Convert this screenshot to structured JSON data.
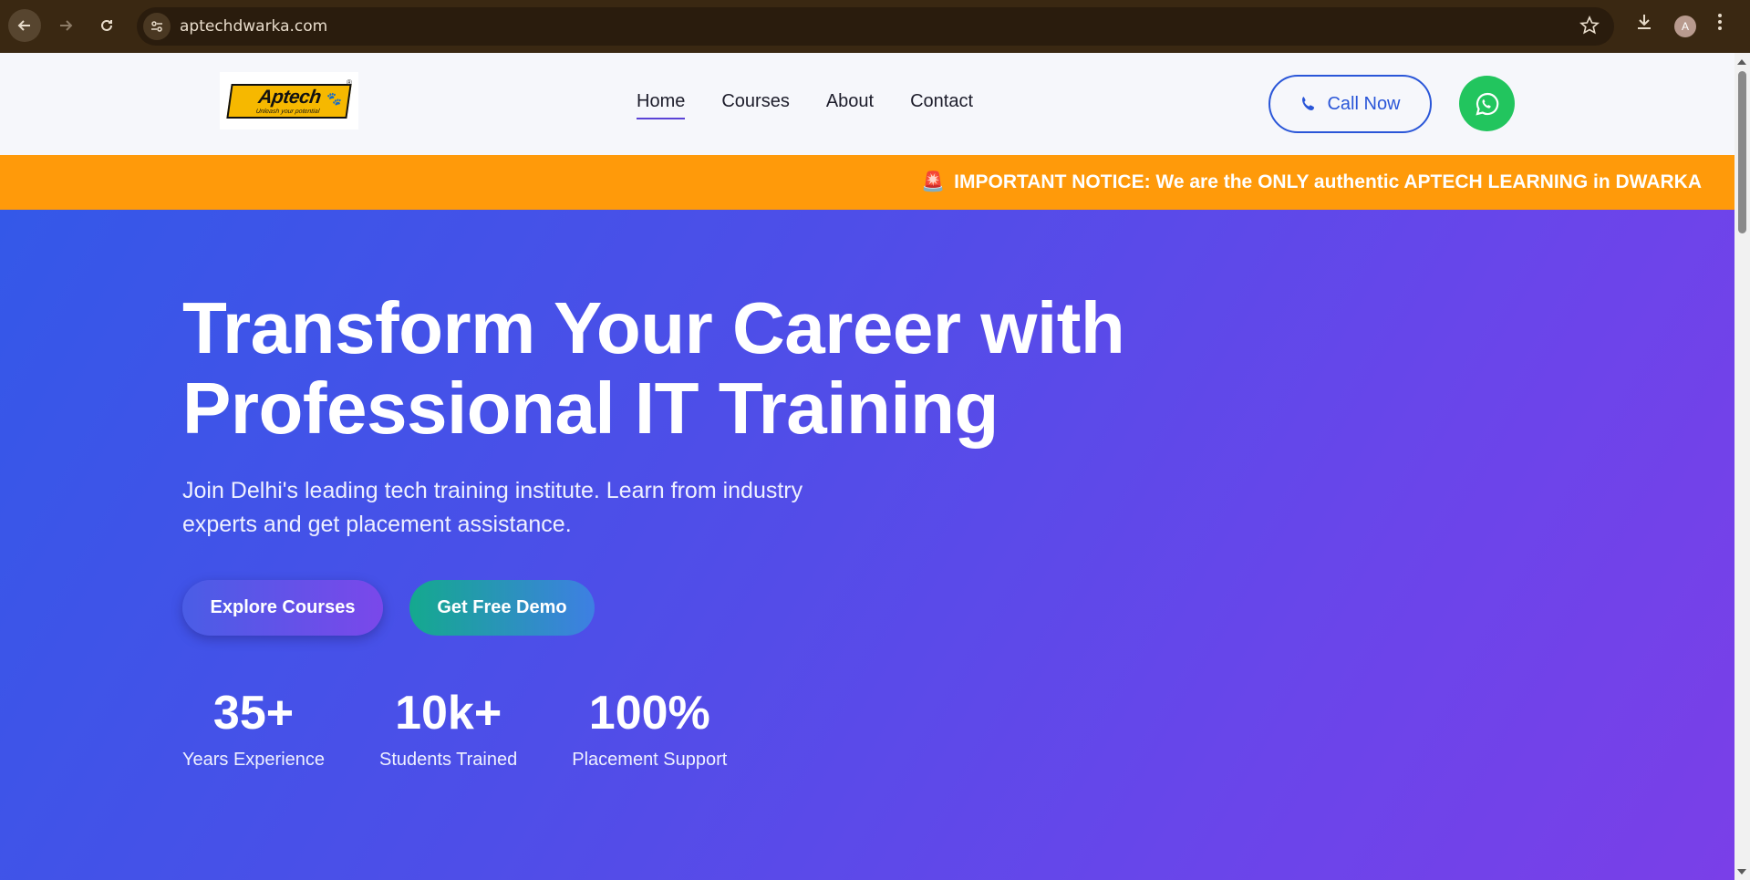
{
  "browser": {
    "url": "aptechdwarka.com",
    "profile_initial": "A",
    "icons": [
      "back-arrow-icon",
      "forward-arrow-icon",
      "reload-icon",
      "site-info-icon",
      "star-icon",
      "download-icon",
      "kebab-menu-icon"
    ]
  },
  "header": {
    "logo": {
      "word": "Aptech",
      "tagline": "Unleash your potential",
      "reg": "®"
    },
    "nav": [
      {
        "label": "Home",
        "active": true
      },
      {
        "label": "Courses",
        "active": false
      },
      {
        "label": "About",
        "active": false
      },
      {
        "label": "Contact",
        "active": false
      }
    ],
    "call_label": "Call Now",
    "colors": {
      "accent": "#2a56d8",
      "whatsapp": "#22c55e"
    }
  },
  "notice": {
    "icon": "siren-icon",
    "text": "IMPORTANT NOTICE: We are the ONLY authentic APTECH LEARNING in DWARKA",
    "background": "#ff9a0a"
  },
  "hero": {
    "title_line1": "Transform Your Career with",
    "title_line2": "Professional IT Training",
    "subtitle": "Join Delhi's leading tech training institute. Learn from industry experts and get placement assistance.",
    "explore_label": "Explore Courses",
    "demo_label": "Get Free Demo",
    "stats": [
      {
        "value": "35+",
        "label": "Years Experience"
      },
      {
        "value": "10k+",
        "label": "Students Trained"
      },
      {
        "value": "100%",
        "label": "Placement Support"
      }
    ]
  }
}
